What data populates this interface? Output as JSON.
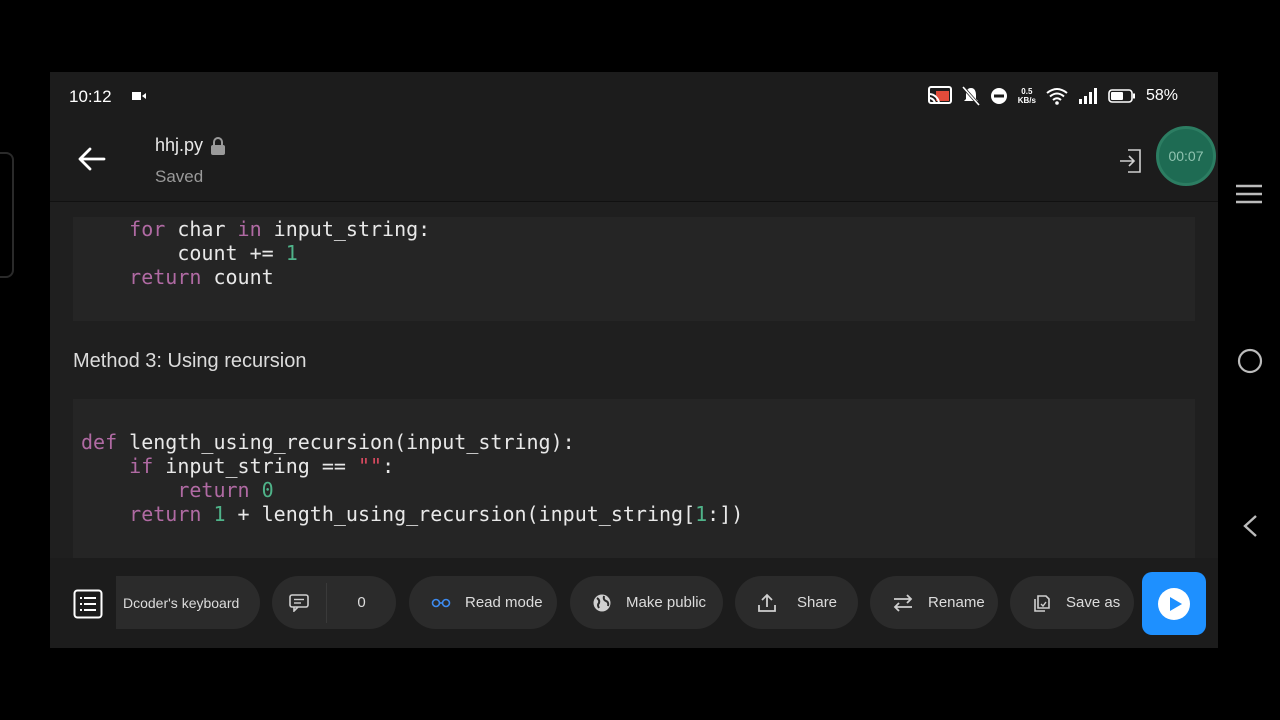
{
  "status_bar": {
    "time": "10:12",
    "net_speed_value": "0.5",
    "net_speed_unit": "KB/s",
    "battery_percent": "58%"
  },
  "header": {
    "file_name": "hhj.py",
    "save_status": "Saved",
    "timer": "00:07"
  },
  "content": {
    "section_heading": "Method 3: Using recursion"
  },
  "toolbar": {
    "keyboard_label": "Dcoder's keyboard",
    "comments_count": "0",
    "read_mode_label": "Read mode",
    "make_public_label": "Make public",
    "share_label": "Share",
    "rename_label": "Rename",
    "save_as_label": "Save as"
  },
  "colors": {
    "keyword": "#b06aa3",
    "number": "#4fb389",
    "string": "#d64a5f",
    "run_button": "#1e90ff",
    "timer_bubble": "#1e6b53"
  }
}
